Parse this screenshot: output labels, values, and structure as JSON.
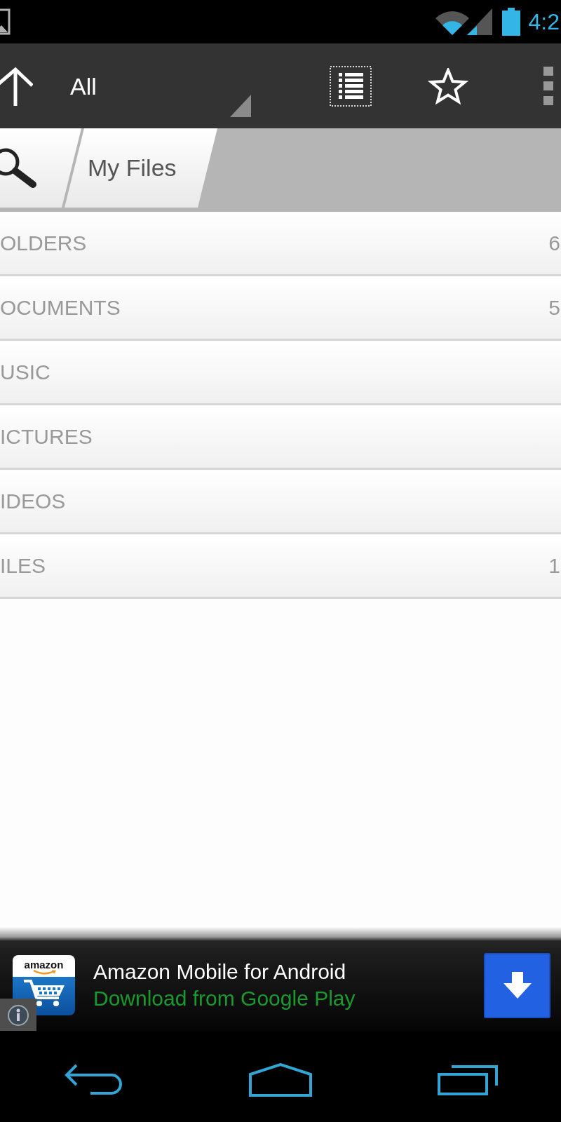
{
  "status_bar": {
    "time": "4:2"
  },
  "action_bar": {
    "title": "All"
  },
  "breadcrumbs": [
    {
      "label": "My Files"
    }
  ],
  "categories": [
    {
      "label": "OLDERS",
      "count": "6"
    },
    {
      "label": "OCUMENTS",
      "count": "5"
    },
    {
      "label": "USIC"
    },
    {
      "label": "ICTURES"
    },
    {
      "label": "IDEOS"
    },
    {
      "label": "ILES",
      "count": "1"
    }
  ],
  "ad": {
    "logo_text": "amazon",
    "title": "Amazon Mobile for Android",
    "subtitle": "Download from Google Play"
  }
}
